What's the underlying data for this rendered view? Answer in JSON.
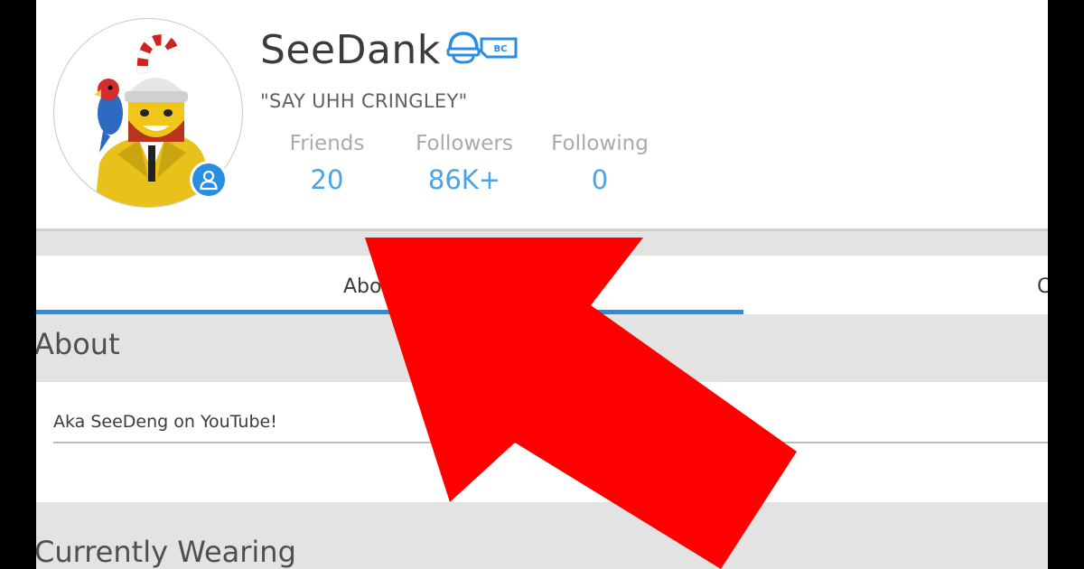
{
  "profile": {
    "username": "SeeDank",
    "membership_badge": "BC",
    "status": "\"SAY UHH CRINGLEY\""
  },
  "stats": [
    {
      "label": "Friends",
      "value": "20"
    },
    {
      "label": "Followers",
      "value": "86K+"
    },
    {
      "label": "Following",
      "value": "0"
    }
  ],
  "tabs": [
    {
      "label": "About"
    },
    {
      "label": "Creations"
    }
  ],
  "about": {
    "heading": "About",
    "description": "Aka SeeDeng on YouTube!"
  },
  "wearing": {
    "heading": "Currently Wearing"
  },
  "colors": {
    "accent": "#2a8ee0",
    "stat_value": "#4aa3e6",
    "arrow": "#ff0000"
  },
  "icons": {
    "presence": "user-icon",
    "membership": "builders-club-icon",
    "overlay": "red-arrow"
  }
}
